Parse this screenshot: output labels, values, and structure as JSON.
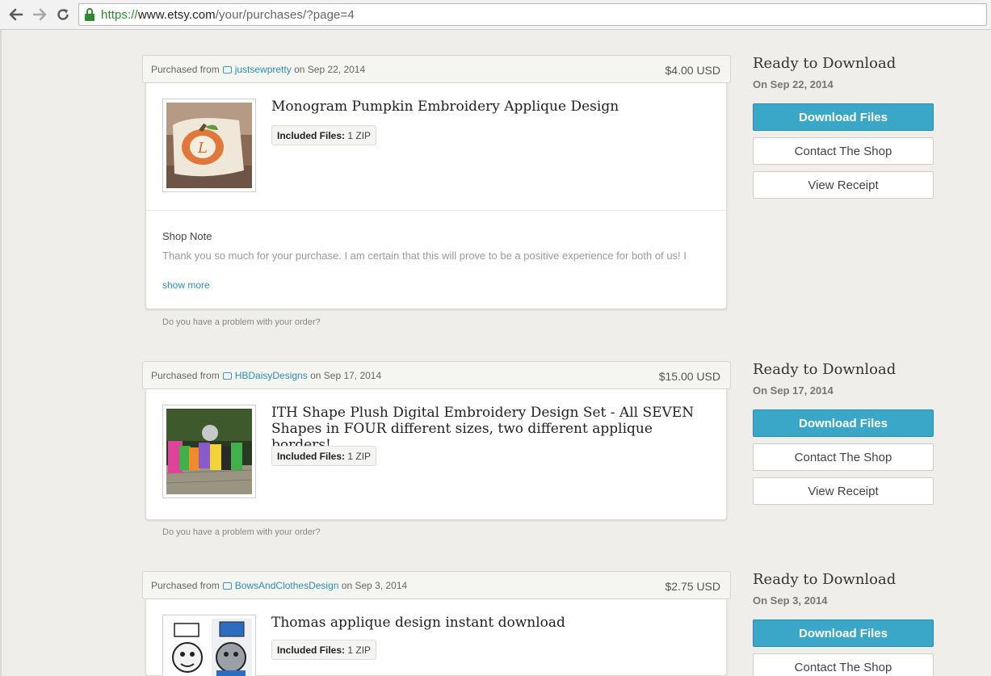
{
  "browser": {
    "url_scheme": "https://",
    "url_host": "www.etsy.com",
    "url_path": "/your/purchases/?page=4"
  },
  "orders": [
    {
      "purchased_from": "Purchased from",
      "shop": "justsewpretty",
      "date_text": "on Sep 22, 2014",
      "price": "$4.00 USD",
      "title": "Monogram Pumpkin Embroidery Applique Design",
      "files_label": "Included Files:",
      "files_value": "1 ZIP",
      "shop_note_label": "Shop Note",
      "shop_note_text": "Thank you so much for your purchase. I am certain that this will prove to be a positive experience for both of us! I strive for excellence in all of my creations. In order for this transaction to be completed",
      "show_more": "show more",
      "problem": "Do you have a problem with your order?",
      "status": "Ready to Download",
      "status_date": "On Sep 22, 2014",
      "download": "Download Files",
      "contact": "Contact The Shop",
      "receipt": "View Receipt"
    },
    {
      "purchased_from": "Purchased from",
      "shop": "HBDaisyDesigns",
      "date_text": "on Sep 17, 2014",
      "price": "$15.00 USD",
      "title": "ITH Shape Plush Digital Embroidery Design Set - All SEVEN Shapes in FOUR different sizes, two different applique borders!",
      "files_label": "Included Files:",
      "files_value": "1 ZIP",
      "problem": "Do you have a problem with your order?",
      "status": "Ready to Download",
      "status_date": "On Sep 17, 2014",
      "download": "Download Files",
      "contact": "Contact The Shop",
      "receipt": "View Receipt"
    },
    {
      "purchased_from": "Purchased from",
      "shop": "BowsAndClothesDesign",
      "date_text": "on Sep 3, 2014",
      "price": "$2.75 USD",
      "title": "Thomas applique design instant download",
      "files_label": "Included Files:",
      "files_value": "1 ZIP",
      "status": "Ready to Download",
      "status_date": "On Sep 3, 2014",
      "download": "Download Files",
      "contact": "Contact The Shop"
    }
  ],
  "colors": {
    "accent": "#3aa7c8",
    "link": "#2f8fb0",
    "background": "#efeeea"
  },
  "icons": [
    "back-arrow-icon",
    "forward-arrow-icon",
    "reload-icon",
    "lock-icon",
    "shop-icon"
  ]
}
